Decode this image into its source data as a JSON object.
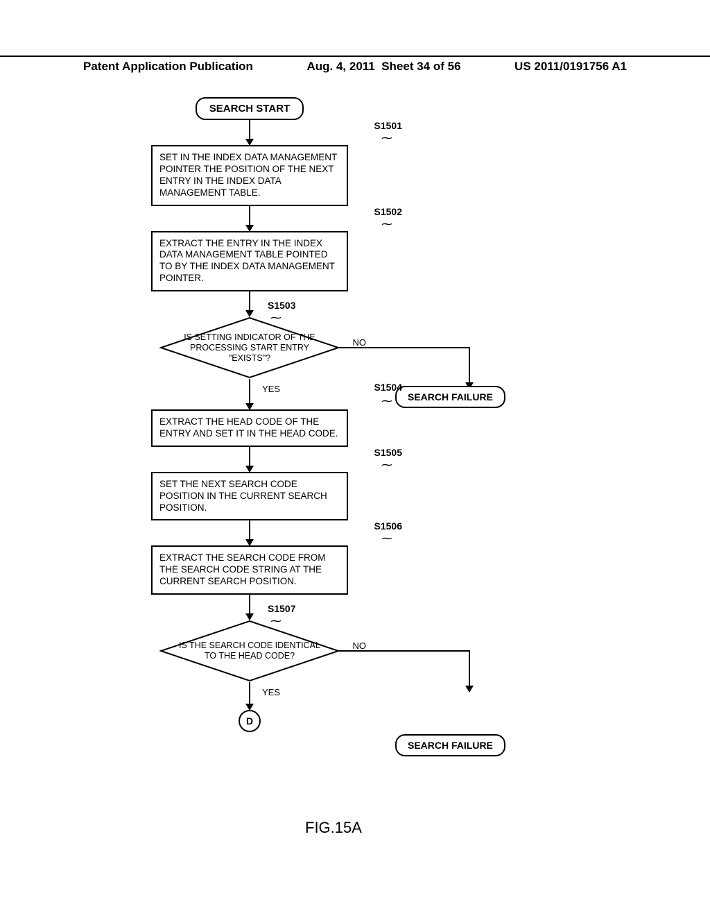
{
  "header": {
    "left": "Patent Application Publication",
    "date": "Aug. 4, 2011",
    "sheet": "Sheet 34 of 56",
    "pubnum": "US 2011/0191756 A1"
  },
  "flow": {
    "start": "SEARCH START",
    "s1501": {
      "tag": "S1501",
      "text": "SET IN THE INDEX DATA MANAGEMENT POINTER THE POSITION OF THE NEXT ENTRY IN THE INDEX DATA MANAGEMENT TABLE."
    },
    "s1502": {
      "tag": "S1502",
      "text": "EXTRACT THE ENTRY IN THE INDEX DATA MANAGEMENT TABLE POINTED TO BY THE INDEX DATA MANAGEMENT POINTER."
    },
    "s1503": {
      "tag": "S1503",
      "text": "IS SETTING INDICATOR OF THE PROCESSING START ENTRY \"EXISTS\"?",
      "yes": "YES",
      "no": "NO"
    },
    "fail1": "SEARCH FAILURE",
    "s1504": {
      "tag": "S1504",
      "text": "EXTRACT THE HEAD CODE OF THE ENTRY AND SET IT IN THE HEAD CODE."
    },
    "s1505": {
      "tag": "S1505",
      "text": "SET THE NEXT SEARCH CODE POSITION IN THE CURRENT SEARCH POSITION."
    },
    "s1506": {
      "tag": "S1506",
      "text": "EXTRACT THE SEARCH CODE FROM THE SEARCH CODE STRING AT THE CURRENT SEARCH POSITION."
    },
    "s1507": {
      "tag": "S1507",
      "text": "IS THE SEARCH CODE IDENTICAL TO THE HEAD CODE?",
      "yes": "YES",
      "no": "NO"
    },
    "fail2": "SEARCH FAILURE",
    "connector": "D"
  },
  "figure_caption": "FIG.15A",
  "chart_data": {
    "type": "flowchart",
    "title": "FIG.15A",
    "nodes": [
      {
        "id": "start",
        "kind": "terminal",
        "label": "SEARCH START"
      },
      {
        "id": "S1501",
        "kind": "process",
        "label": "SET IN THE INDEX DATA MANAGEMENT POINTER THE POSITION OF THE NEXT ENTRY IN THE INDEX DATA MANAGEMENT TABLE."
      },
      {
        "id": "S1502",
        "kind": "process",
        "label": "EXTRACT THE ENTRY IN THE INDEX DATA MANAGEMENT TABLE POINTED TO BY THE INDEX DATA MANAGEMENT POINTER."
      },
      {
        "id": "S1503",
        "kind": "decision",
        "label": "IS SETTING INDICATOR OF THE PROCESSING START ENTRY \"EXISTS\"?"
      },
      {
        "id": "fail1",
        "kind": "terminal",
        "label": "SEARCH FAILURE"
      },
      {
        "id": "S1504",
        "kind": "process",
        "label": "EXTRACT THE HEAD CODE OF THE ENTRY AND SET IT IN THE HEAD CODE."
      },
      {
        "id": "S1505",
        "kind": "process",
        "label": "SET THE NEXT SEARCH CODE POSITION IN THE CURRENT SEARCH POSITION."
      },
      {
        "id": "S1506",
        "kind": "process",
        "label": "EXTRACT THE SEARCH CODE FROM THE SEARCH CODE STRING AT THE CURRENT SEARCH POSITION."
      },
      {
        "id": "S1507",
        "kind": "decision",
        "label": "IS THE SEARCH CODE IDENTICAL TO THE HEAD CODE?"
      },
      {
        "id": "fail2",
        "kind": "terminal",
        "label": "SEARCH FAILURE"
      },
      {
        "id": "D",
        "kind": "connector",
        "label": "D"
      }
    ],
    "edges": [
      {
        "from": "start",
        "to": "S1501"
      },
      {
        "from": "S1501",
        "to": "S1502"
      },
      {
        "from": "S1502",
        "to": "S1503"
      },
      {
        "from": "S1503",
        "to": "S1504",
        "label": "YES"
      },
      {
        "from": "S1503",
        "to": "fail1",
        "label": "NO"
      },
      {
        "from": "S1504",
        "to": "S1505"
      },
      {
        "from": "S1505",
        "to": "S1506"
      },
      {
        "from": "S1506",
        "to": "S1507"
      },
      {
        "from": "S1507",
        "to": "D",
        "label": "YES"
      },
      {
        "from": "S1507",
        "to": "fail2",
        "label": "NO"
      }
    ]
  }
}
